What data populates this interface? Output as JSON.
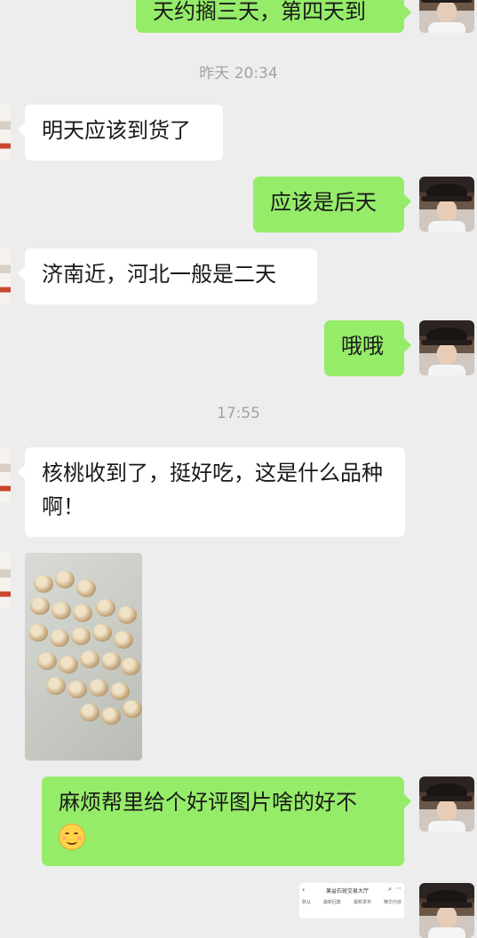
{
  "messages": {
    "top_partial": "天约搁三天，第四天到",
    "ts1": "昨天 20:34",
    "m1": "明天应该到货了",
    "m2": "应该是后天",
    "m3": "济南近，河北一般是二天",
    "m4": "哦哦",
    "ts2": "17:55",
    "m5": "核桃收到了，挺好吃，这是什么品种啊！",
    "m6": "麻烦帮里给个好评图片啥的好不",
    "m6_emoji": "smiling-emoji"
  },
  "screenshot_preview": {
    "title": "果益石斑交易大厅",
    "tabs": [
      "默认",
      "最新回复",
      "最新发布",
      "精华内容"
    ]
  },
  "colors": {
    "background": "#ededed",
    "incoming_bubble": "#ffffff",
    "outgoing_bubble": "#95ec69",
    "timestamp": "#a3a3a3"
  }
}
